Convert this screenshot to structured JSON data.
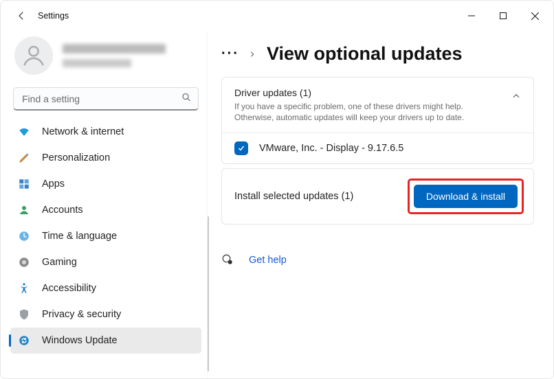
{
  "titlebar": {
    "app_title": "Settings"
  },
  "profile": {
    "name_obscured": "█████████",
    "email_obscured": "████████"
  },
  "search": {
    "placeholder": "Find a setting"
  },
  "sidebar": {
    "items": [
      {
        "label": "Network & internet"
      },
      {
        "label": "Personalization"
      },
      {
        "label": "Apps"
      },
      {
        "label": "Accounts"
      },
      {
        "label": "Time & language"
      },
      {
        "label": "Gaming"
      },
      {
        "label": "Accessibility"
      },
      {
        "label": "Privacy & security"
      },
      {
        "label": "Windows Update"
      }
    ]
  },
  "breadcrumb": {
    "page_title": "View optional updates"
  },
  "driver_section": {
    "title": "Driver updates (1)",
    "sub": "If you have a specific problem, one of these drivers might help. Otherwise, automatic updates will keep your drivers up to date.",
    "item": "VMware, Inc. - Display - 9.17.6.5"
  },
  "install_section": {
    "label": "Install selected updates (1)",
    "button": "Download & install"
  },
  "help": {
    "label": "Get help"
  }
}
